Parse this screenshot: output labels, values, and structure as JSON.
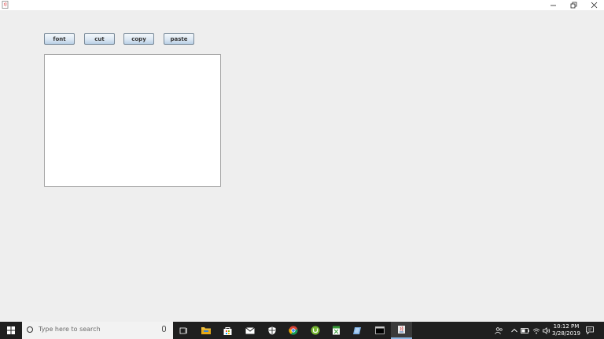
{
  "toolbar": {
    "buttons": [
      "font",
      "cut",
      "copy",
      "paste"
    ]
  },
  "editor": {
    "text": ""
  },
  "taskbar": {
    "search_placeholder": "Type here to search",
    "clock_time": "10:12 PM",
    "clock_date": "3/28/2019"
  },
  "colors": {
    "window_bg": "#eeeeee",
    "taskbar_bg": "#1f1f1f",
    "button_border": "#7a8a99"
  }
}
